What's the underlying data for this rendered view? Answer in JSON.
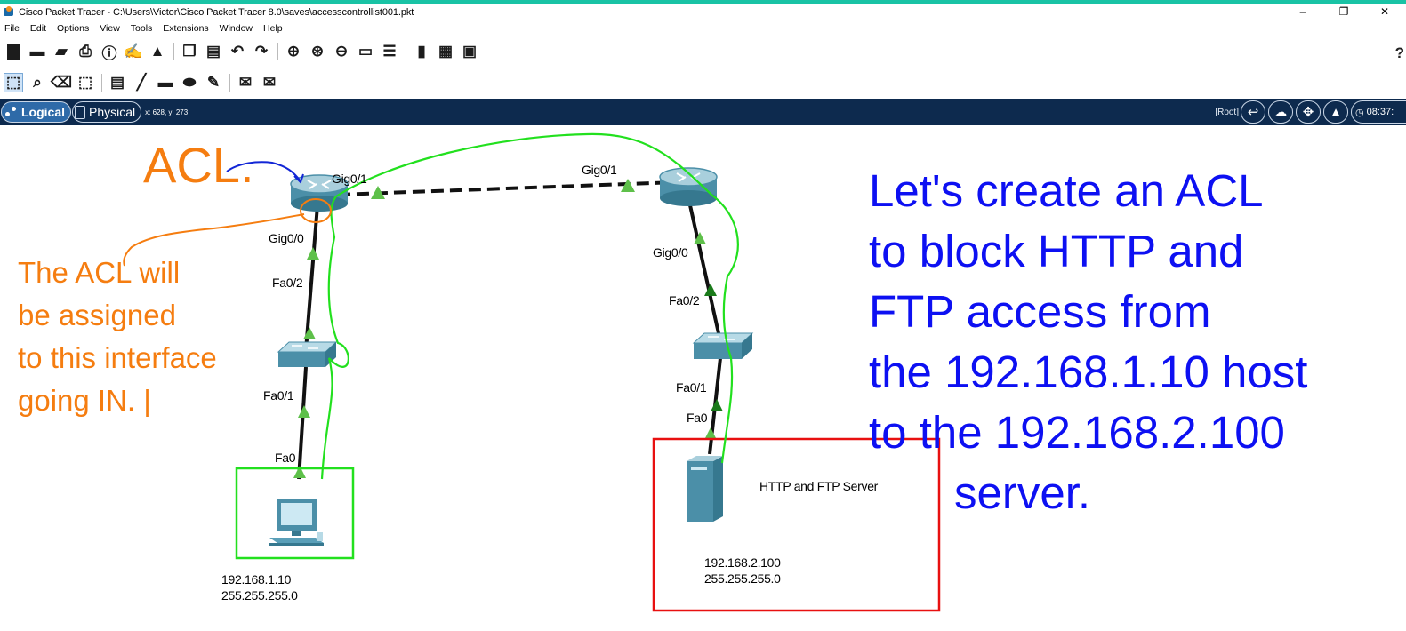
{
  "window": {
    "title": "Cisco Packet Tracer - C:\\Users\\Victor\\Cisco Packet Tracer 8.0\\saves\\accesscontrollist001.pkt",
    "controls": [
      "–",
      "❐",
      "✕"
    ]
  },
  "menu": [
    "File",
    "Edit",
    "Options",
    "View",
    "Tools",
    "Extensions",
    "Window",
    "Help"
  ],
  "toolbar_main": [
    {
      "name": "new-file-icon",
      "glyph": "▇"
    },
    {
      "name": "open-folder-icon",
      "glyph": "▬"
    },
    {
      "name": "save-icon",
      "glyph": "▰"
    },
    {
      "name": "print-icon",
      "glyph": "⎙"
    },
    {
      "name": "info-icon",
      "glyph": "ⓘ"
    },
    {
      "name": "activity-wizard-icon",
      "glyph": "✍"
    },
    {
      "name": "network-info-icon",
      "glyph": "▲"
    },
    {
      "name": "copy-icon",
      "glyph": "❐"
    },
    {
      "name": "paste-icon",
      "glyph": "▤"
    },
    {
      "name": "undo-icon",
      "glyph": "↶"
    },
    {
      "name": "redo-icon",
      "glyph": "↷"
    },
    {
      "name": "zoom-in-icon",
      "glyph": "⊕"
    },
    {
      "name": "zoom-reset-icon",
      "glyph": "⊛"
    },
    {
      "name": "zoom-out-icon",
      "glyph": "⊖"
    },
    {
      "name": "drawing-palette-icon",
      "glyph": "▭"
    },
    {
      "name": "custom-devices-icon",
      "glyph": "☰"
    },
    {
      "name": "viewport-icon",
      "glyph": "▮"
    },
    {
      "name": "server-icon",
      "glyph": "▦"
    },
    {
      "name": "camera-icon",
      "glyph": "▣"
    }
  ],
  "toolbar_tools": [
    {
      "name": "select-icon",
      "glyph": "⬚"
    },
    {
      "name": "inspect-icon",
      "glyph": "⌕"
    },
    {
      "name": "delete-icon",
      "glyph": "⌫"
    },
    {
      "name": "resize-icon",
      "glyph": "⬚"
    },
    {
      "name": "note-icon",
      "glyph": "▤"
    },
    {
      "name": "line-icon",
      "glyph": "╱"
    },
    {
      "name": "rectangle-icon",
      "glyph": "▬"
    },
    {
      "name": "ellipse-icon",
      "glyph": "⬬"
    },
    {
      "name": "freeform-icon",
      "glyph": "✎"
    },
    {
      "name": "simple-pdu-icon",
      "glyph": "✉"
    },
    {
      "name": "complex-pdu-icon",
      "glyph": "✉"
    }
  ],
  "help_glyph": "?",
  "workspace": {
    "logical_label": "Logical",
    "physical_label": "Physical",
    "coords": "x: 628, y: 273",
    "root_label": "[Root]",
    "time": "08:37:"
  },
  "network": {
    "labels": {
      "r1_gig01": "Gig0/1",
      "r1_gig00": "Gig0/0",
      "s1_fa02": "Fa0/2",
      "s1_fa01": "Fa0/1",
      "pc_fa0": "Fa0",
      "r2_gig01": "Gig0/1",
      "r2_gig00": "Gig0/0",
      "s2_fa02": "Fa0/2",
      "s2_fa01": "Fa0/1",
      "srv_fa0": "Fa0"
    },
    "pc": {
      "ip": "192.168.1.10",
      "mask": "255.255.255.0"
    },
    "server": {
      "name": "HTTP and FTP Server",
      "ip": "192.168.2.100",
      "mask": "255.255.255.0"
    }
  },
  "annotations": {
    "acl_title": "ACL.",
    "acl_note": [
      "The ACL will",
      "be assigned",
      "to this interface",
      "going IN. |"
    ],
    "main_note": [
      "Let's create an ACL",
      "to block HTTP and",
      "FTP access from",
      "the 192.168.1.10 host",
      "to the 192.168.2.100",
      "server."
    ]
  },
  "colors": {
    "workspace_bar": "#0d2a4e",
    "annotation_orange": "#f57d10",
    "annotation_blue": "#0d10f2",
    "drawn_green": "#22e01e",
    "link_up": "#5ec04a"
  }
}
